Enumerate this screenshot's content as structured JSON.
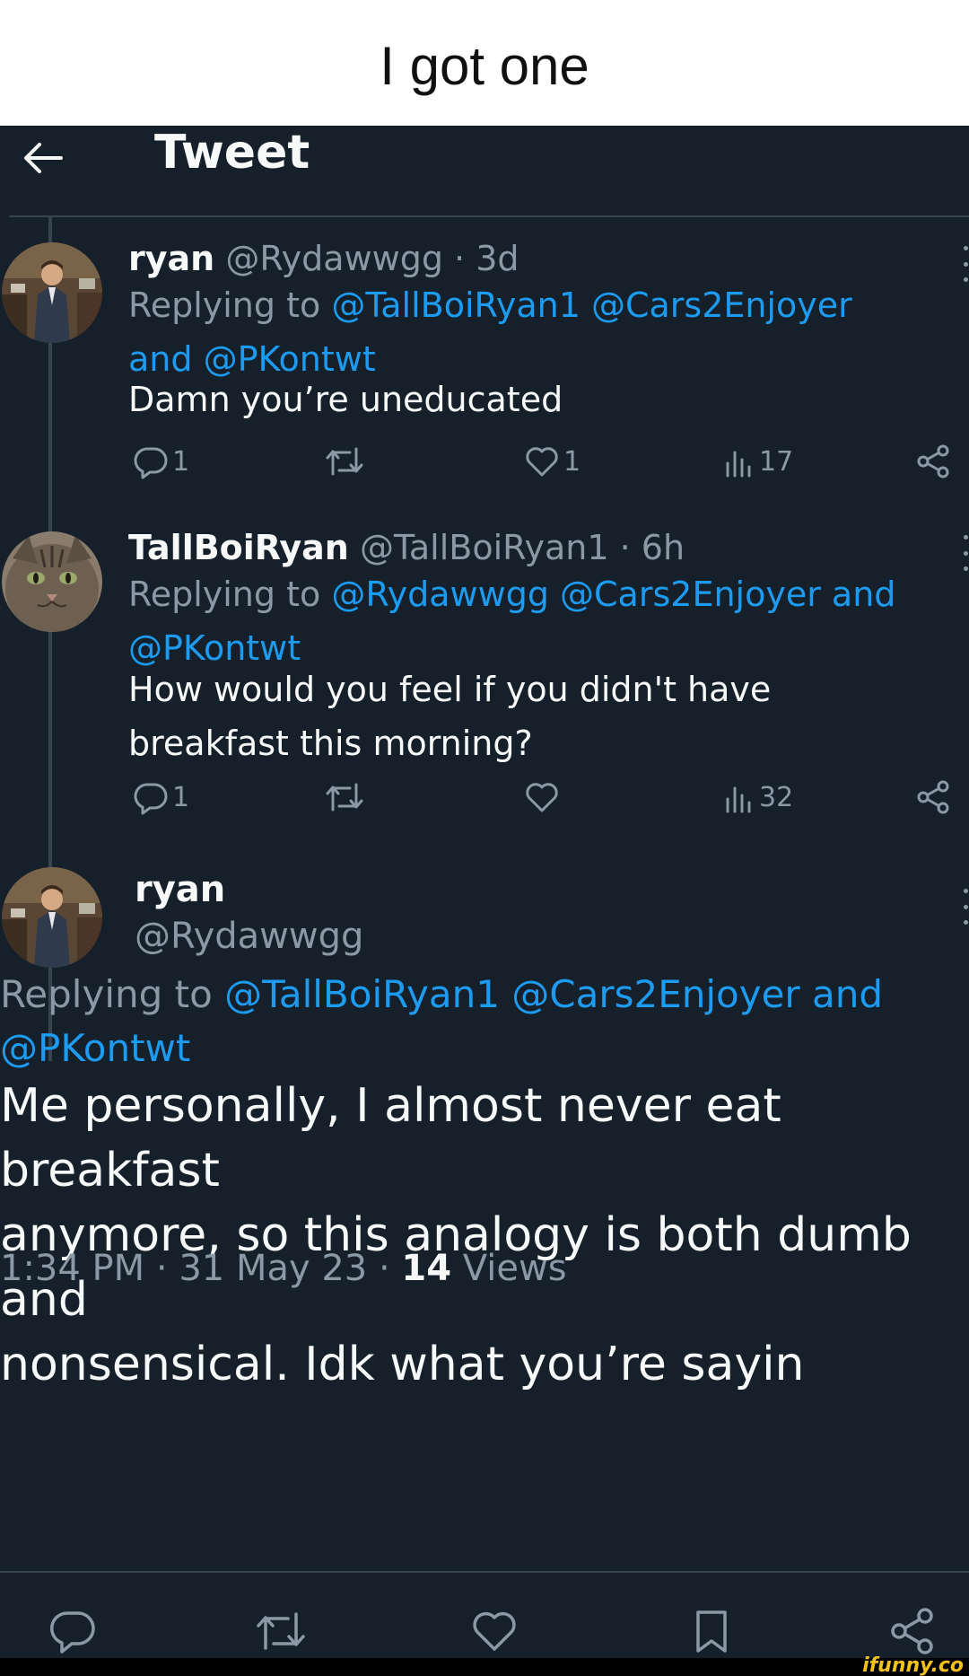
{
  "caption": "I got one",
  "header": {
    "title": "Tweet"
  },
  "tweets": [
    {
      "name": "ryan",
      "handle": "@Rydawwgg",
      "sep": "·",
      "time": "3d",
      "replying_prefix": "Replying to",
      "replying_line1": "@TallBoiRyan1 @Cars2Enjoyer",
      "replying_line2": "and @PKontwt",
      "text": "Damn you’re uneducated",
      "replies": "1",
      "likes": "1",
      "views": "17"
    },
    {
      "name": "TallBoiRyan",
      "handle": "@TallBoiRyan1",
      "sep": "·",
      "time": "6h",
      "replying_prefix": "Replying to",
      "replying_line1": "@Rydawwgg @Cars2Enjoyer and",
      "replying_line2": "@PKontwt",
      "text_line1": "How would you feel if you didn't have",
      "text_line2": "breakfast this morning?",
      "replies": "1",
      "views": "32"
    }
  ],
  "main_tweet": {
    "name": "ryan",
    "handle": "@Rydawwgg",
    "replying_prefix": "Replying to",
    "replying_line1": "@TallBoiRyan1 @Cars2Enjoyer and",
    "replying_line2": "@PKontwt",
    "text_line1": "Me personally, I almost never eat breakfast",
    "text_line2": "anymore, so this analogy is both dumb and",
    "text_line3": "nonsensical. Idk what you’re sayin",
    "time": "1:34 PM",
    "date": "31 May 23",
    "views_count": "14",
    "views_label": "Views",
    "sep": "·"
  },
  "watermark": "ifunny.co",
  "colors": {
    "background": "#15202b",
    "text": "#f7f9f9",
    "muted": "#8b98a5",
    "link": "#1d9bf0",
    "divider": "#38444d"
  },
  "icons": [
    "back-arrow-icon",
    "reply-icon",
    "retweet-icon",
    "like-icon",
    "views-icon",
    "share-icon",
    "bookmark-icon",
    "more-icon"
  ]
}
